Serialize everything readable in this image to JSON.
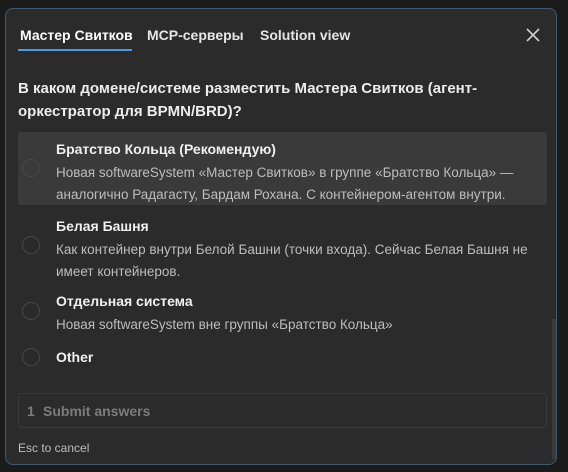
{
  "tabs": [
    {
      "label": "Мастер Свитков",
      "active": true
    },
    {
      "label": "MCP-серверы",
      "active": false
    },
    {
      "label": "Solution view",
      "active": false
    }
  ],
  "close_icon": "close-icon",
  "question": "В каком домене/системе разместить Мастера Свитков (агент-оркестратор для BPMN/BRD)?",
  "options": [
    {
      "title": "Братство Кольца (Рекомендую)",
      "description": "Новая softwareSystem «Мастер Свитков» в группе «Братство Кольца» — аналогично Радагасту, Бардам Рохана. С контейнером-агентом внутри.",
      "selected": true
    },
    {
      "title": "Белая Башня",
      "description": "Как контейнер внутри Белой Башни (точки входа). Сейчас Белая Башня не имеет контейнеров.",
      "selected": false
    },
    {
      "title": "Отдельная система",
      "description": "Новая softwareSystem вне группы «Братство Кольца»",
      "selected": false
    },
    {
      "title": "Other",
      "description": "",
      "selected": false
    }
  ],
  "submit": {
    "count": "1",
    "label": "Submit answers"
  },
  "hint": "Esc to cancel",
  "colors": {
    "accent": "#4a9ae0",
    "background": "#2b2b2b",
    "border": "#3d5a72",
    "selected_row": "#3a3a3a"
  }
}
